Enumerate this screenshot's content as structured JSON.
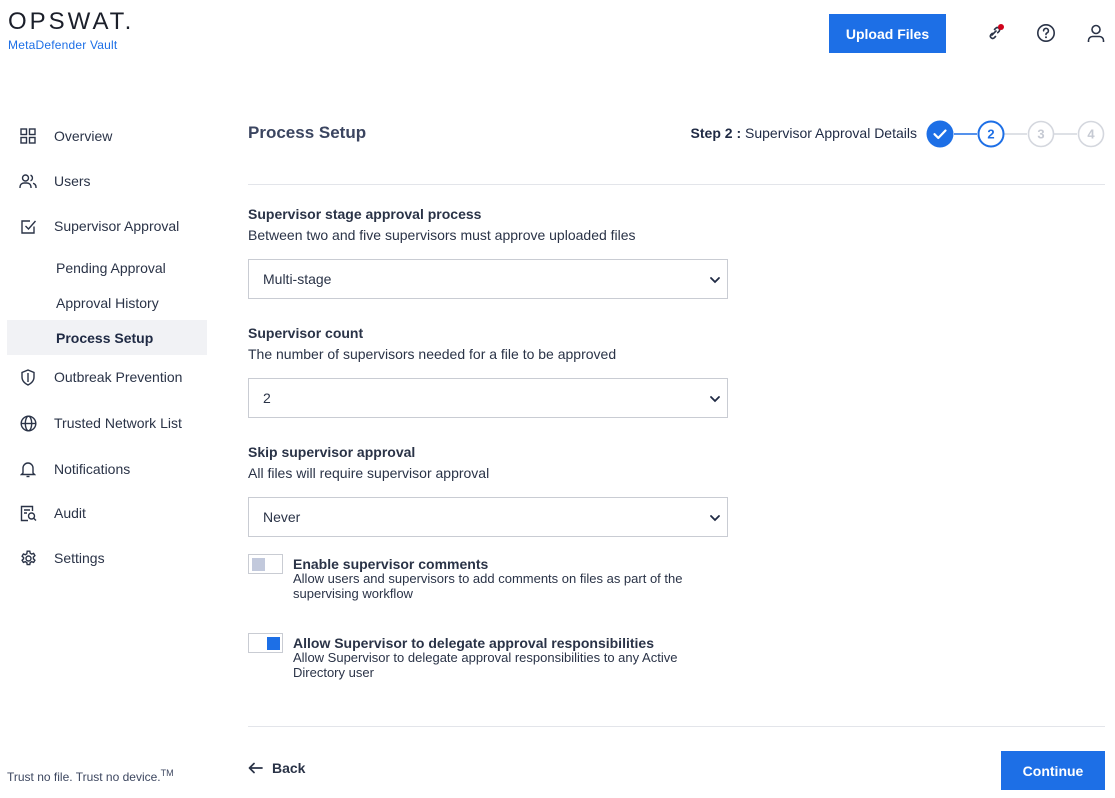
{
  "header": {
    "logo_text": "OPSWAT.",
    "product_name": "MetaDefender Vault",
    "upload_label": "Upload Files",
    "icons": [
      "link-notification-icon",
      "help-icon",
      "user-icon"
    ]
  },
  "sidebar": {
    "items": [
      {
        "label": "Overview",
        "icon": "grid-icon"
      },
      {
        "label": "Users",
        "icon": "users-icon"
      },
      {
        "label": "Supervisor Approval",
        "icon": "checkbox-icon"
      },
      {
        "label": "Outbreak Prevention",
        "icon": "shield-icon"
      },
      {
        "label": "Trusted Network List",
        "icon": "globe-icon"
      },
      {
        "label": "Notifications",
        "icon": "bell-icon"
      },
      {
        "label": "Audit",
        "icon": "audit-icon"
      },
      {
        "label": "Settings",
        "icon": "gear-icon"
      }
    ],
    "sub_items": [
      {
        "label": "Pending Approval"
      },
      {
        "label": "Approval History"
      },
      {
        "label": "Process Setup",
        "active": true
      }
    ],
    "tagline": "Trust no file. Trust no device.",
    "tagline_mark": "TM"
  },
  "main": {
    "title": "Process Setup",
    "step_prefix": "Step 2 :",
    "step_name": "Supervisor Approval Details",
    "stepper": {
      "steps": [
        "1",
        "2",
        "3",
        "4"
      ],
      "current": 2,
      "completed": 1
    },
    "sections": [
      {
        "title": "Supervisor stage approval process",
        "description": "Between two and five supervisors must approve uploaded files",
        "value": "Multi-stage"
      },
      {
        "title": "Supervisor count",
        "description": "The number of supervisors needed for a file to be approved",
        "value": "2"
      },
      {
        "title": "Skip supervisor approval",
        "description": "All files will require supervisor approval",
        "value": "Never"
      }
    ],
    "toggles": [
      {
        "title": "Enable supervisor comments",
        "description": "Allow users and supervisors to add comments on files as part of the supervising workflow",
        "enabled": false
      },
      {
        "title": "Allow Supervisor to delegate approval responsibilities",
        "description": "Allow Supervisor to delegate approval responsibilities to any Active Directory user",
        "enabled": true
      }
    ],
    "back_label": "Back",
    "continue_label": "Continue"
  },
  "colors": {
    "accent": "#1d6fe6",
    "notification_dot": "#d0021b"
  }
}
